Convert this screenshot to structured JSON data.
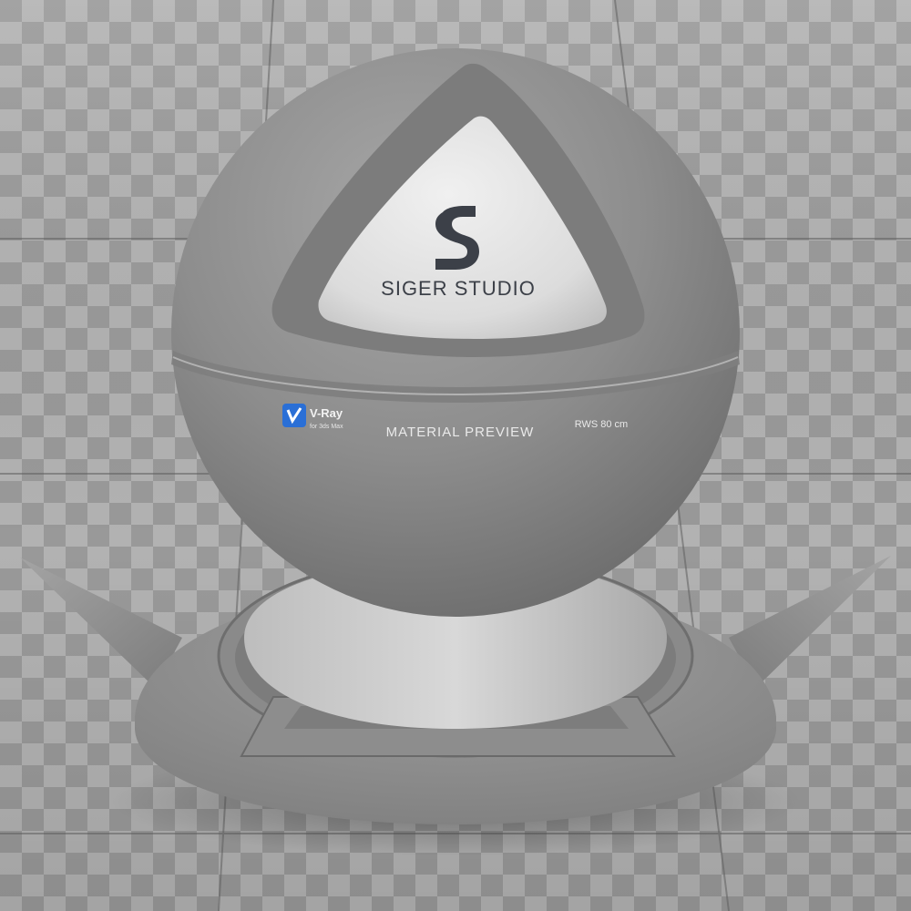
{
  "logo": {
    "studio_name": "SIGER STUDIO",
    "monogram": "S"
  },
  "band": {
    "vray_brand": "V-Ray",
    "vray_sub": "for 3ds Max",
    "preview_label": "MATERIAL PREVIEW",
    "scale_label": "RWS 80 cm"
  },
  "colors": {
    "material": "#8e8e8e",
    "checker_light": "#b4b4b4",
    "checker_dark": "#9a9a9a",
    "logo_dark": "#3c4048",
    "vray_blue": "#2a6fd6"
  }
}
